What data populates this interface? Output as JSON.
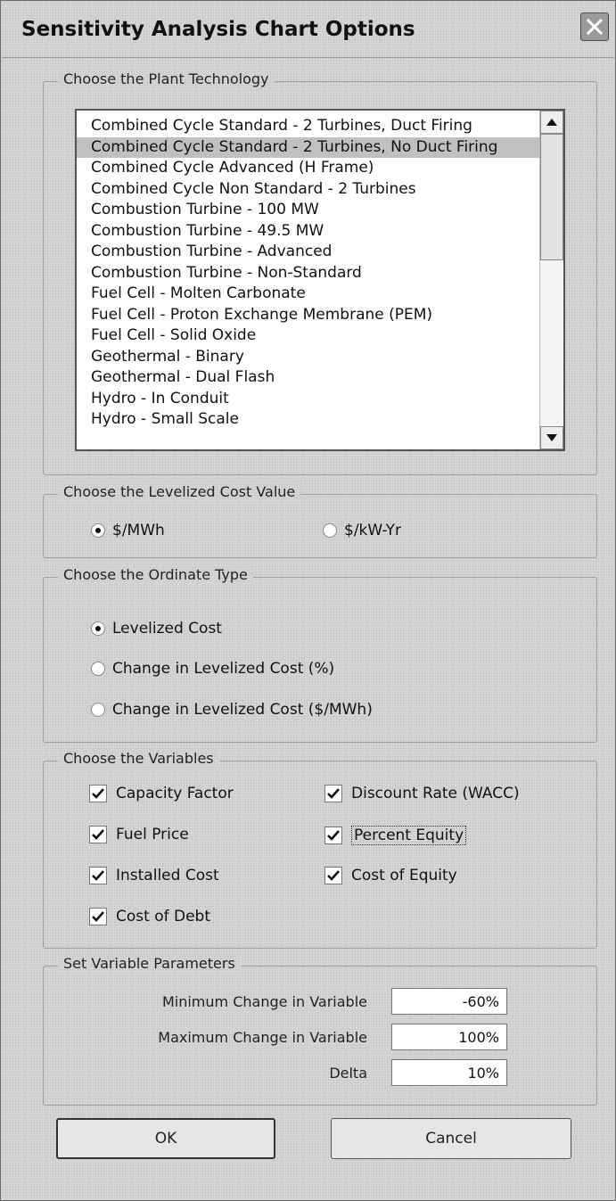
{
  "window": {
    "title": "Sensitivity Analysis Chart Options"
  },
  "technology": {
    "label": "Choose the Plant Technology",
    "selected_index": 1,
    "items": [
      "Combined Cycle Standard - 2 Turbines, Duct Firing",
      "Combined Cycle Standard - 2 Turbines, No Duct Firing",
      "Combined Cycle Advanced (H Frame)",
      "Combined Cycle Non Standard - 2 Turbines",
      "Combustion Turbine - 100 MW",
      "Combustion Turbine - 49.5 MW",
      "Combustion Turbine - Advanced",
      "Combustion Turbine - Non-Standard",
      "Fuel Cell - Molten Carbonate",
      "Fuel Cell -  Proton Exchange  Membrane (PEM)",
      "Fuel Cell - Solid Oxide",
      "Geothermal - Binary",
      "Geothermal - Dual Flash",
      "Hydro - In Conduit",
      "Hydro - Small Scale"
    ]
  },
  "levelized": {
    "label": "Choose the Levelized Cost Value",
    "options": [
      {
        "label": "$/MWh",
        "checked": true
      },
      {
        "label": "$/kW-Yr",
        "checked": false
      }
    ]
  },
  "ordinate": {
    "label": "Choose the Ordinate Type",
    "options": [
      {
        "label": "Levelized Cost",
        "checked": true
      },
      {
        "label": "Change in Levelized Cost (%)",
        "checked": false
      },
      {
        "label": "Change in Levelized Cost ($/MWh)",
        "checked": false
      }
    ]
  },
  "variables": {
    "label": "Choose the Variables",
    "items": [
      {
        "label": "Capacity Factor",
        "checked": true
      },
      {
        "label": "Fuel Price",
        "checked": true
      },
      {
        "label": "Installed Cost",
        "checked": true
      },
      {
        "label": "Cost of Debt",
        "checked": true
      },
      {
        "label": "Discount Rate (WACC)",
        "checked": true
      },
      {
        "label": "Percent Equity",
        "checked": true
      },
      {
        "label": "Cost of Equity",
        "checked": true
      }
    ]
  },
  "params": {
    "label": "Set Variable Parameters",
    "min_label": "Minimum Change in Variable",
    "min_value": "-60%",
    "max_label": "Maximum Change in Variable",
    "max_value": "100%",
    "delta_label": "Delta",
    "delta_value": "10%"
  },
  "buttons": {
    "ok": "OK",
    "cancel": "Cancel"
  }
}
